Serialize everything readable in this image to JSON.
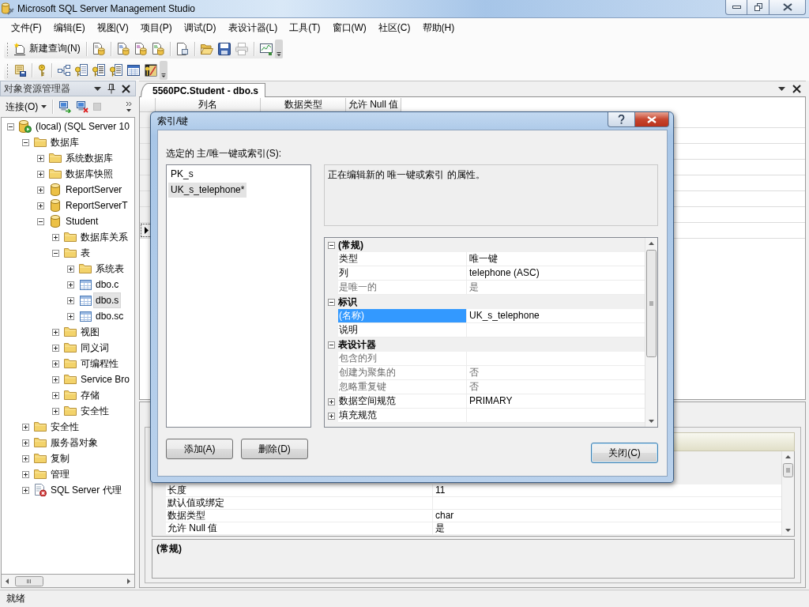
{
  "window": {
    "title": "Microsoft SQL Server Management Studio"
  },
  "menu": [
    "文件(F)",
    "编辑(E)",
    "视图(V)",
    "项目(P)",
    "调试(D)",
    "表设计器(L)",
    "工具(T)",
    "窗口(W)",
    "社区(C)",
    "帮助(H)"
  ],
  "standard_toolbar": {
    "new_query": "新建查询(N)",
    "print_disabled": true
  },
  "object_explorer": {
    "title": "对象资源管理器",
    "connect": "连接(O)",
    "stop_disabled": true,
    "tree": [
      {
        "label": "(local) (SQL Server 10",
        "kind": "server",
        "expanded": true,
        "selected": false,
        "children": [
          {
            "label": "数据库",
            "kind": "folder",
            "expanded": true,
            "selected": false,
            "children": [
              {
                "label": "系统数据库",
                "kind": "folder",
                "expanded": false,
                "selected": false
              },
              {
                "label": "数据库快照",
                "kind": "folder",
                "expanded": false,
                "selected": false
              },
              {
                "label": "ReportServer",
                "kind": "database",
                "expanded": false,
                "selected": false
              },
              {
                "label": "ReportServerT",
                "kind": "database",
                "expanded": false,
                "selected": false
              },
              {
                "label": "Student",
                "kind": "database",
                "expanded": true,
                "selected": false,
                "children": [
                  {
                    "label": "数据库关系",
                    "kind": "folder",
                    "expanded": false,
                    "selected": false
                  },
                  {
                    "label": "表",
                    "kind": "folder",
                    "expanded": true,
                    "selected": false,
                    "children": [
                      {
                        "label": "系统表",
                        "kind": "folder",
                        "expanded": false,
                        "selected": false
                      },
                      {
                        "label": "dbo.c",
                        "kind": "table",
                        "expanded": false,
                        "selected": false
                      },
                      {
                        "label": "dbo.s",
                        "kind": "table",
                        "expanded": false,
                        "selected": true
                      },
                      {
                        "label": "dbo.sc",
                        "kind": "table",
                        "expanded": false,
                        "selected": false
                      }
                    ]
                  },
                  {
                    "label": "视图",
                    "kind": "folder",
                    "expanded": false,
                    "selected": false
                  },
                  {
                    "label": "同义词",
                    "kind": "folder",
                    "expanded": false,
                    "selected": false
                  },
                  {
                    "label": "可编程性",
                    "kind": "folder",
                    "expanded": false,
                    "selected": false
                  },
                  {
                    "label": "Service Bro",
                    "kind": "folder",
                    "expanded": false,
                    "selected": false
                  },
                  {
                    "label": "存储",
                    "kind": "folder",
                    "expanded": false,
                    "selected": false
                  },
                  {
                    "label": "安全性",
                    "kind": "folder",
                    "expanded": false,
                    "selected": false
                  }
                ]
              }
            ]
          },
          {
            "label": "安全性",
            "kind": "folder",
            "expanded": false,
            "selected": false
          },
          {
            "label": "服务器对象",
            "kind": "folder",
            "expanded": false,
            "selected": false
          },
          {
            "label": "复制",
            "kind": "folder",
            "expanded": false,
            "selected": false
          },
          {
            "label": "管理",
            "kind": "folder",
            "expanded": false,
            "selected": false
          },
          {
            "label": "SQL Server 代理",
            "kind": "agent",
            "expanded": false,
            "selected": false
          }
        ]
      }
    ]
  },
  "document_tabs": [
    {
      "title": "5560PC.Student - dbo.s",
      "selected": true
    }
  ],
  "table_designer": {
    "columns": [
      "列名",
      "数据类型",
      "允许 Null 值"
    ],
    "rows": [
      {
        "selected": false
      },
      {
        "selected": false
      },
      {
        "selected": false
      },
      {
        "selected": false
      },
      {
        "selected": false
      },
      {
        "selected": false
      },
      {
        "selected": false
      },
      {
        "selected": true
      }
    ]
  },
  "column_properties": {
    "rows": [
      {
        "name": "长度",
        "value": "11"
      },
      {
        "name": "默认值或绑定"
      },
      {
        "name": "数据类型",
        "value": "char"
      },
      {
        "name": "允许 Null 值",
        "value": "是"
      }
    ],
    "description_title": "(常规)"
  },
  "dialog": {
    "title": "索引/键",
    "list_label": "选定的 主/唯一键或索引(S):",
    "items": [
      {
        "label": "PK_s",
        "selected": false
      },
      {
        "label": "UK_s_telephone*",
        "selected": true
      }
    ],
    "description": "正在编辑新的 唯一键或索引 的属性。",
    "properties": [
      {
        "category": "(常规)",
        "expanded": true,
        "rows": [
          {
            "name": "类型",
            "value": "唯一键",
            "kind": "plain",
            "readonly": false,
            "selected": false
          },
          {
            "name": "列",
            "value": "telephone (ASC)",
            "kind": "plain",
            "readonly": false,
            "selected": false
          },
          {
            "name": "是唯一的",
            "value": "是",
            "kind": "plain",
            "readonly": true,
            "selected": false
          }
        ]
      },
      {
        "category": "标识",
        "expanded": true,
        "rows": [
          {
            "name": "(名称)",
            "value": "UK_s_telephone",
            "kind": "plain",
            "readonly": false,
            "selected": true
          },
          {
            "name": "说明",
            "kind": "plain",
            "readonly": false,
            "selected": false
          }
        ]
      },
      {
        "category": "表设计器",
        "expanded": true,
        "rows": [
          {
            "name": "包含的列",
            "kind": "plain",
            "readonly": true,
            "selected": false
          },
          {
            "name": "创建为聚集的",
            "value": "否",
            "kind": "plain",
            "readonly": true,
            "selected": false
          },
          {
            "name": "忽略重复键",
            "value": "否",
            "kind": "plain",
            "readonly": true,
            "selected": false
          },
          {
            "name": "数据空间规范",
            "value": "PRIMARY",
            "kind": "expandable",
            "expanded": false,
            "readonly": false,
            "selected": false
          },
          {
            "name": "填充规范",
            "kind": "expandable",
            "expanded": false,
            "readonly": false,
            "selected": false
          }
        ]
      }
    ],
    "buttons": [
      {
        "label": "添加(A)",
        "default": false
      },
      {
        "label": "删除(D)",
        "default": false
      },
      {
        "label": "关闭(C)",
        "default": true
      }
    ]
  },
  "status_bar": {
    "text": "就绪"
  }
}
